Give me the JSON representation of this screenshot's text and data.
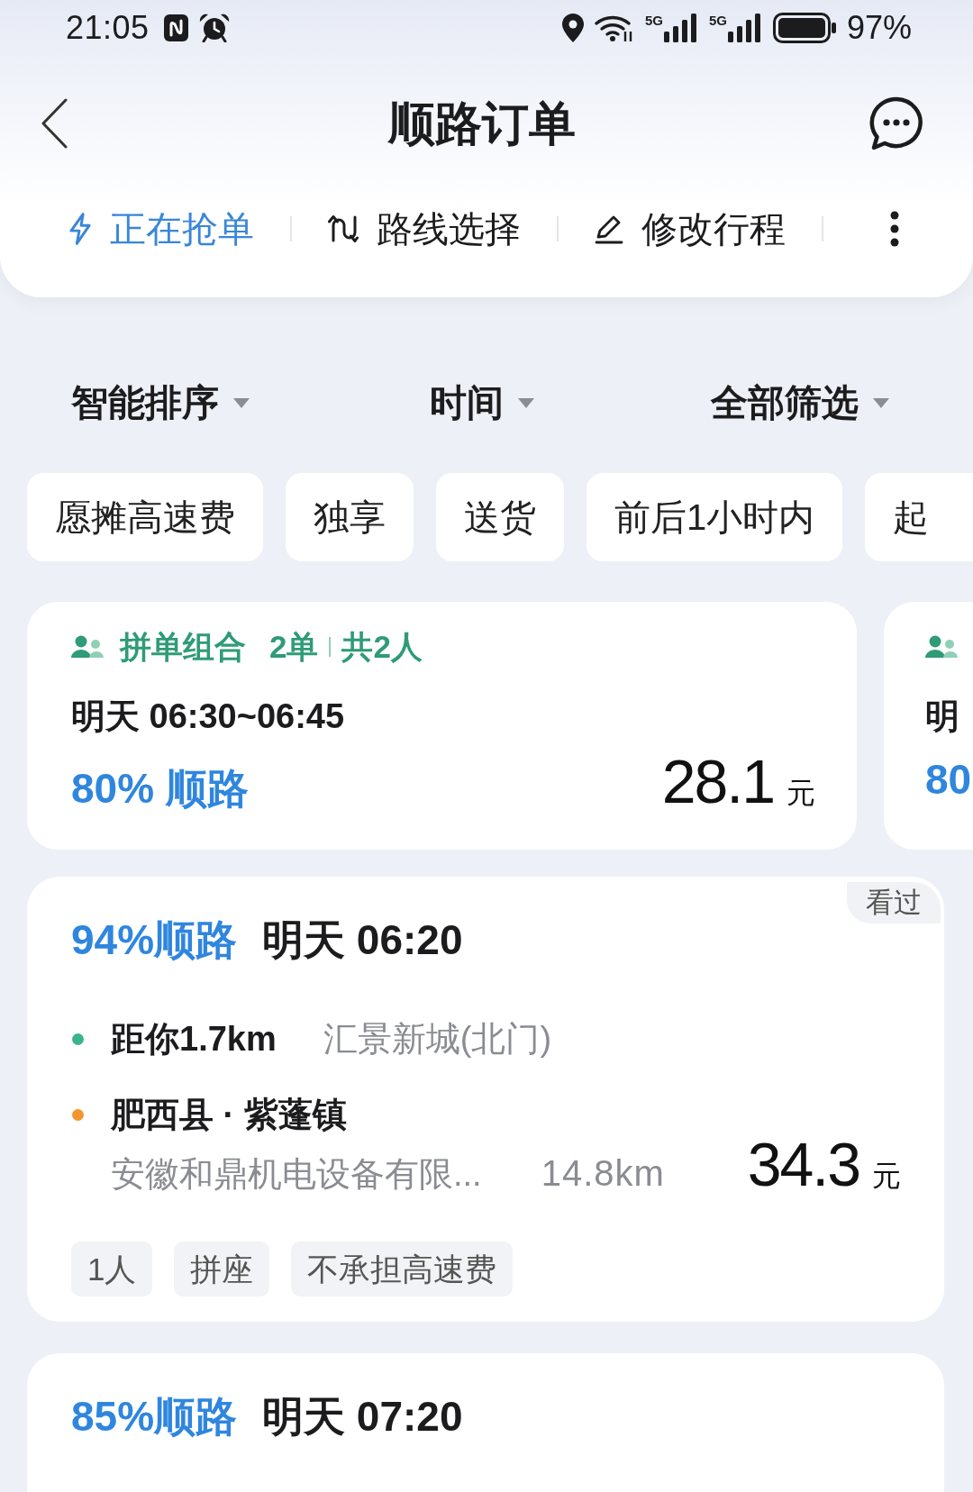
{
  "status_bar": {
    "time": "21:05",
    "network_labels": [
      "5G",
      "5G"
    ],
    "battery_percent": "97%"
  },
  "header": {
    "title": "顺路订单"
  },
  "actions": [
    {
      "kind": "bolt",
      "label": "正在抢单",
      "on": true
    },
    {
      "kind": "route",
      "label": "路线选择",
      "on": false
    },
    {
      "kind": "pencil",
      "label": "修改行程",
      "on": false
    }
  ],
  "sort_options": [
    {
      "label": "智能排序"
    },
    {
      "label": "时间"
    },
    {
      "label": "全部筛选"
    }
  ],
  "filter_chips": [
    {
      "label": "愿摊高速费",
      "selected": false
    },
    {
      "label": "独享",
      "selected": false
    },
    {
      "label": "送货",
      "selected": false
    },
    {
      "label": "前后1小时内",
      "selected": false
    },
    {
      "label": "起",
      "selected": false
    }
  ],
  "combo_cards": [
    {
      "title": "拼单组合",
      "order_count": "2单",
      "passengers": "共2人",
      "time": "明天 06:30~06:45",
      "match": "80% 顺路",
      "price": "28.1",
      "unit": "元"
    },
    {
      "time": "明",
      "match": "80"
    }
  ],
  "orders": [
    {
      "match": "94%顺路",
      "time": "明天 06:20",
      "viewed_label": "看过",
      "stops": [
        {
          "kind": "pickup",
          "color": "#3cb48a",
          "title": "距你1.7km",
          "detail": "汇景新城(北门)"
        },
        {
          "kind": "dropoff",
          "color": "#f2962c",
          "title": "肥西县 · 紫蓬镇",
          "detail": "安徽和鼎机电设备有限...",
          "distance": "14.8km"
        }
      ],
      "price": "34.3",
      "unit": "元",
      "tags": [
        "1人",
        "拼座",
        "不承担高速费"
      ]
    },
    {
      "match": "85%顺路",
      "time": "明天 07:20"
    }
  ]
}
